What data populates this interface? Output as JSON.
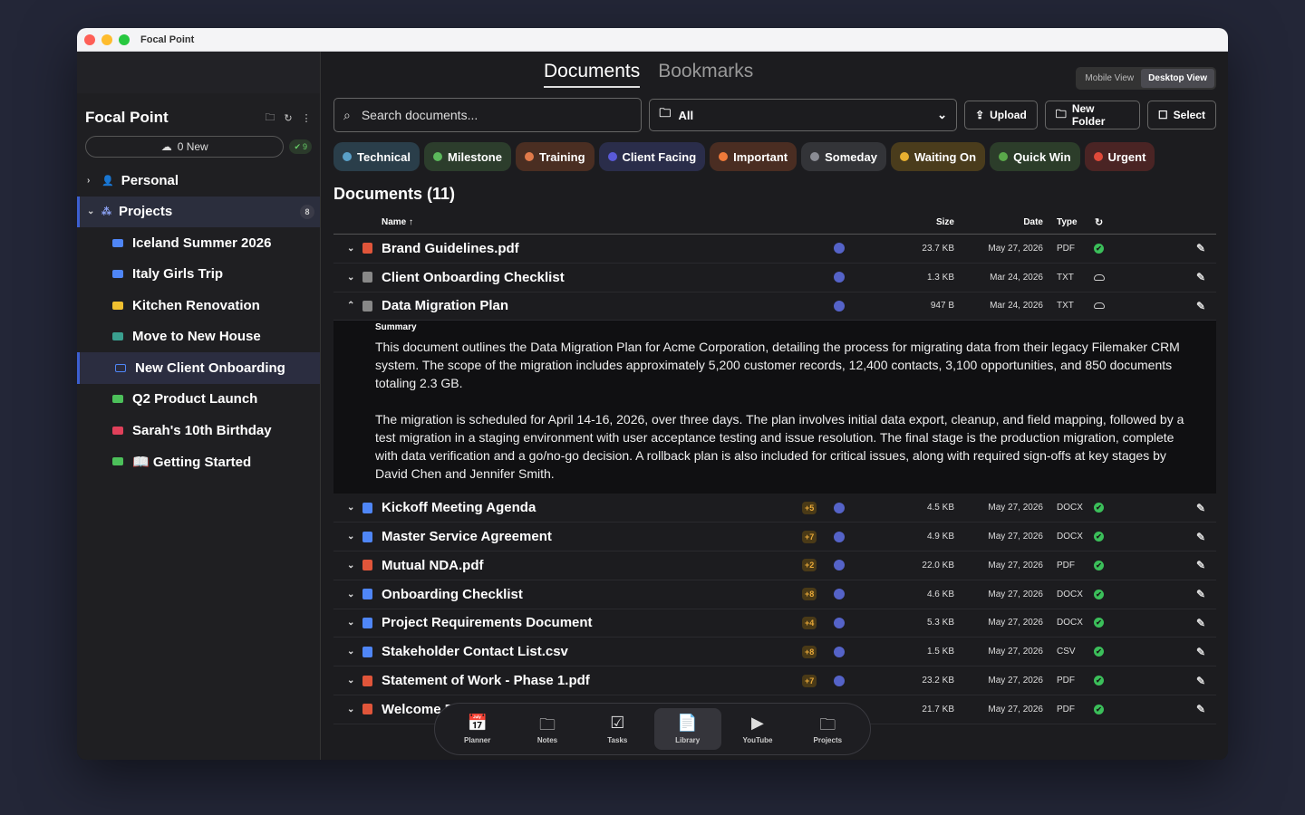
{
  "window": {
    "title": "Focal Point"
  },
  "sidebar": {
    "title": "Focal Point",
    "sync_label": "0 New",
    "sync_count": "9",
    "items": [
      {
        "label": "Personal",
        "kind": "group"
      },
      {
        "label": "Projects",
        "kind": "group",
        "count": "8"
      }
    ],
    "projects": [
      {
        "label": "Iceland Summer 2026",
        "color": "#4f86f7"
      },
      {
        "label": "Italy Girls Trip",
        "color": "#4f86f7"
      },
      {
        "label": "Kitchen Renovation",
        "color": "#f0c030"
      },
      {
        "label": "Move to New House",
        "color": "#3a9f8f"
      },
      {
        "label": "New Client Onboarding",
        "color": "#4f86f7"
      },
      {
        "label": "Q2 Product Launch",
        "color": "#4cc05a"
      },
      {
        "label": "Sarah's 10th Birthday",
        "color": "#e0405a"
      },
      {
        "label": "📖 Getting Started",
        "color": "#4cc05a"
      }
    ]
  },
  "tabs": [
    "Documents",
    "Bookmarks"
  ],
  "view_toggle": [
    "Mobile View",
    "Desktop View"
  ],
  "search": {
    "placeholder": "Search documents..."
  },
  "filter": {
    "value": "All"
  },
  "buttons": {
    "upload": "Upload",
    "new_folder": "New Folder",
    "select": "Select"
  },
  "tags": [
    {
      "label": "Technical",
      "bg": "#2a3e4a",
      "dot": "#5aa0c8"
    },
    {
      "label": "Milestone",
      "bg": "#2c3d2c",
      "dot": "#5cb85c"
    },
    {
      "label": "Training",
      "bg": "#4a2e22",
      "dot": "#e07a4a"
    },
    {
      "label": "Client Facing",
      "bg": "#2a2d4a",
      "dot": "#5a5ad8"
    },
    {
      "label": "Important",
      "bg": "#4a2d22",
      "dot": "#f07a3a"
    },
    {
      "label": "Someday",
      "bg": "#333438",
      "dot": "#8a8c94"
    },
    {
      "label": "Waiting On",
      "bg": "#4a3c1c",
      "dot": "#e8b030"
    },
    {
      "label": "Quick Win",
      "bg": "#2c3d2a",
      "dot": "#5aa84a"
    },
    {
      "label": "Urgent",
      "bg": "#4a2424",
      "dot": "#e04a3a"
    }
  ],
  "documents_heading": "Documents (11)",
  "columns": {
    "name": "Name ↑",
    "size": "Size",
    "date": "Date",
    "type": "Type"
  },
  "rows": [
    {
      "name": "Brand Guidelines.pdf",
      "badge": "",
      "size": "23.7 KB",
      "date": "May 27, 2026",
      "type": "PDF",
      "status": "synced",
      "icon": "#e0553a"
    },
    {
      "name": "Client Onboarding Checklist",
      "badge": "",
      "size": "1.3 KB",
      "date": "Mar 24, 2026",
      "type": "TXT",
      "status": "cloud",
      "icon": "#888"
    },
    {
      "name": "Data Migration Plan",
      "badge": "",
      "size": "947 B",
      "date": "Mar 24, 2026",
      "type": "TXT",
      "status": "cloud",
      "icon": "#888",
      "expanded": true
    },
    {
      "name": "Kickoff Meeting Agenda",
      "badge": "+5",
      "size": "4.5 KB",
      "date": "May 27, 2026",
      "type": "DOCX",
      "status": "synced",
      "icon": "#4f86f7"
    },
    {
      "name": "Master Service Agreement",
      "badge": "+7",
      "size": "4.9 KB",
      "date": "May 27, 2026",
      "type": "DOCX",
      "status": "synced",
      "icon": "#4f86f7"
    },
    {
      "name": "Mutual NDA.pdf",
      "badge": "+2",
      "size": "22.0 KB",
      "date": "May 27, 2026",
      "type": "PDF",
      "status": "synced",
      "icon": "#e0553a"
    },
    {
      "name": "Onboarding Checklist",
      "badge": "+8",
      "size": "4.6 KB",
      "date": "May 27, 2026",
      "type": "DOCX",
      "status": "synced",
      "icon": "#4f86f7"
    },
    {
      "name": "Project Requirements Document",
      "badge": "+4",
      "size": "5.3 KB",
      "date": "May 27, 2026",
      "type": "DOCX",
      "status": "synced",
      "icon": "#4f86f7"
    },
    {
      "name": "Stakeholder Contact List.csv",
      "badge": "+8",
      "size": "1.5 KB",
      "date": "May 27, 2026",
      "type": "CSV",
      "status": "synced",
      "icon": "#4f86f7"
    },
    {
      "name": "Statement of Work - Phase 1.pdf",
      "badge": "+7",
      "size": "23.2 KB",
      "date": "May 27, 2026",
      "type": "PDF",
      "status": "synced",
      "icon": "#e0553a"
    },
    {
      "name": "Welcome P",
      "badge": "",
      "size": "21.7 KB",
      "date": "May 27, 2026",
      "type": "PDF",
      "status": "synced",
      "icon": "#e0553a"
    }
  ],
  "summary": {
    "heading": "Summary",
    "p1": "This document outlines the Data Migration Plan for Acme Corporation, detailing the process for migrating data from their legacy Filemaker CRM system. The scope of the migration includes approximately 5,200 customer records, 12,400 contacts, 3,100 opportunities, and 850 documents totaling 2.3 GB.",
    "p2": "The migration is scheduled for April 14-16, 2026, over three days. The plan involves initial data export, cleanup, and field mapping, followed by a test migration in a staging environment with user acceptance testing and issue resolution. The final stage is the production migration, complete with data verification and a go/no-go decision. A rollback plan is also included for critical issues, along with required sign-offs at key stages by David Chen and Jennifer Smith."
  },
  "nav": [
    {
      "label": "Planner",
      "icon": "📅"
    },
    {
      "label": "Notes",
      "icon": "🗀"
    },
    {
      "label": "Tasks",
      "icon": "☑"
    },
    {
      "label": "Library",
      "icon": "📄",
      "active": true
    },
    {
      "label": "YouTube",
      "icon": "▶"
    },
    {
      "label": "Projects",
      "icon": "🗀"
    }
  ]
}
